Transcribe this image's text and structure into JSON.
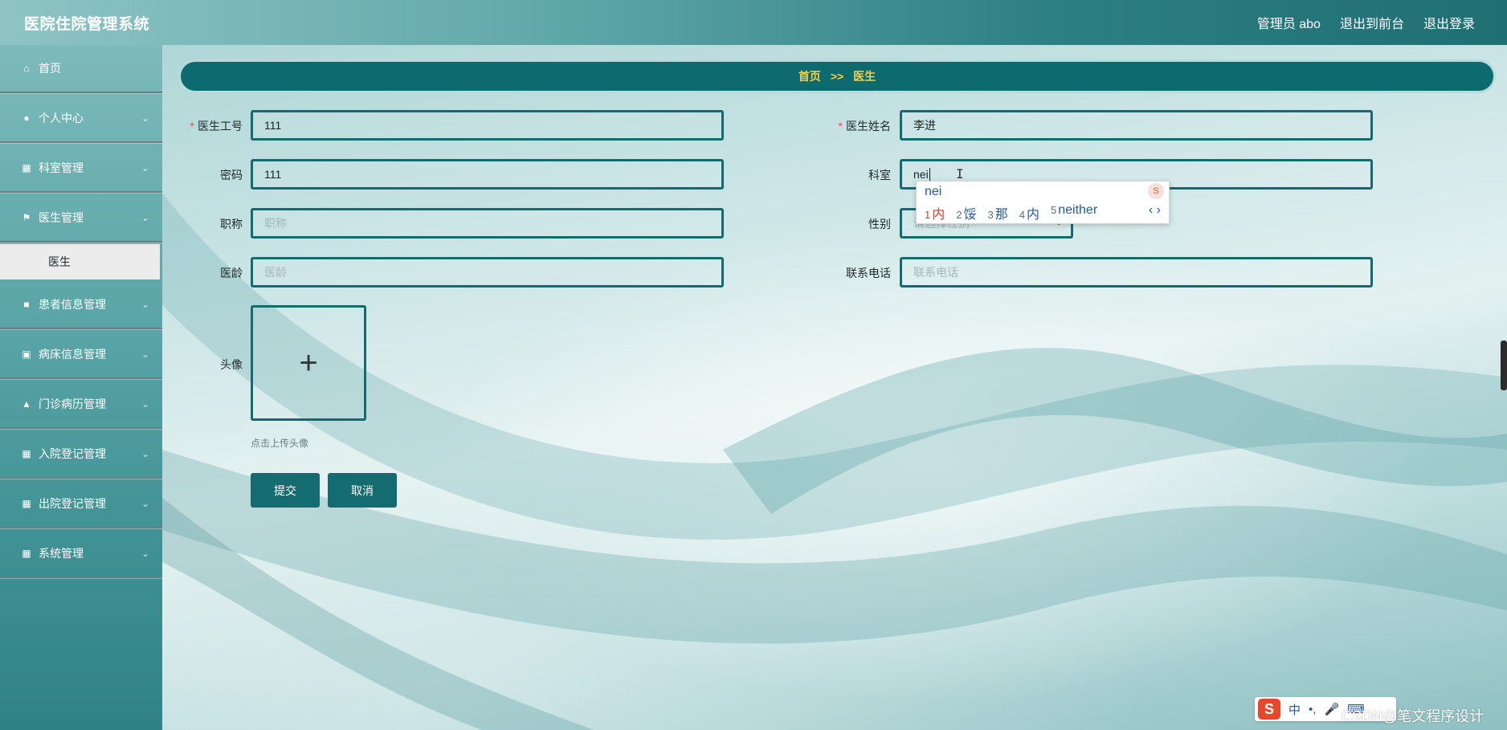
{
  "header": {
    "app_title": "医院住院管理系统",
    "user_label": "管理员 abo",
    "front_link": "退出到前台",
    "logout_link": "退出登录"
  },
  "sidebar": {
    "items": [
      {
        "label": "首页",
        "icon": "home-icon"
      },
      {
        "label": "个人中心",
        "icon": "user-icon"
      },
      {
        "label": "科室管理",
        "icon": "grid-icon"
      },
      {
        "label": "医生管理",
        "icon": "flag-icon"
      },
      {
        "label": "患者信息管理",
        "icon": "comment-icon"
      },
      {
        "label": "病床信息管理",
        "icon": "briefcase-icon"
      },
      {
        "label": "门诊病历管理",
        "icon": "thumb-icon"
      },
      {
        "label": "入院登记管理",
        "icon": "grid-icon"
      },
      {
        "label": "出院登记管理",
        "icon": "grid-icon"
      },
      {
        "label": "系统管理",
        "icon": "grid-icon"
      }
    ],
    "active_sub": "医生"
  },
  "breadcrumb": {
    "home": "首页",
    "sep": ">>",
    "current": "医生"
  },
  "form": {
    "doctor_id": {
      "label": "医生工号",
      "value": "111"
    },
    "doctor_name": {
      "label": "医生姓名",
      "value": "李进"
    },
    "password": {
      "label": "密码",
      "value": "111"
    },
    "department": {
      "label": "科室",
      "value": "nei"
    },
    "title": {
      "label": "职称",
      "placeholder": "职称"
    },
    "gender": {
      "label": "性别",
      "placeholder": "请选择性别"
    },
    "years": {
      "label": "医龄",
      "placeholder": "医龄"
    },
    "phone": {
      "label": "联系电话",
      "placeholder": "联系电话"
    },
    "avatar": {
      "label": "头像",
      "hint": "点击上传头像"
    },
    "submit": "提交",
    "cancel": "取消"
  },
  "ime": {
    "composition": "nei",
    "candidates": [
      {
        "num": "1",
        "text": "内"
      },
      {
        "num": "2",
        "text": "馁"
      },
      {
        "num": "3",
        "text": "那"
      },
      {
        "num": "4",
        "text": "内"
      },
      {
        "num": "5",
        "text": "neither"
      }
    ],
    "nav": "‹ ›",
    "toolbar": {
      "logo": "S",
      "mode": "中",
      "punct": "•,"
    }
  },
  "watermark": "CSDN@笔文程序设计",
  "colors": {
    "primary": "#0d6b6f",
    "breadcrumb_text": "#f2d048",
    "sidebar_active_bg": "#ececec"
  }
}
